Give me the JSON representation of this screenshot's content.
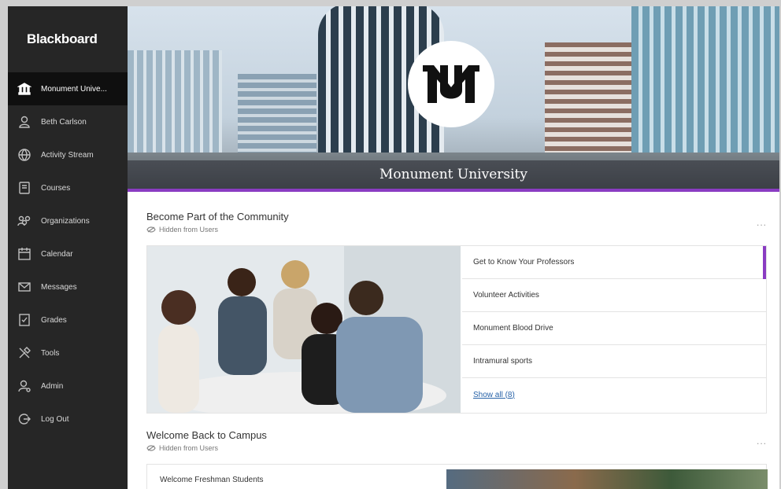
{
  "sidebar": {
    "brand": "Blackboard",
    "items": [
      {
        "label": "Monument Unive...",
        "icon": "institution-icon",
        "active": true
      },
      {
        "label": "Beth Carlson",
        "icon": "user-icon"
      },
      {
        "label": "Activity Stream",
        "icon": "globe-icon"
      },
      {
        "label": "Courses",
        "icon": "book-icon"
      },
      {
        "label": "Organizations",
        "icon": "people-icon"
      },
      {
        "label": "Calendar",
        "icon": "calendar-icon"
      },
      {
        "label": "Messages",
        "icon": "envelope-icon"
      },
      {
        "label": "Grades",
        "icon": "grades-icon"
      },
      {
        "label": "Tools",
        "icon": "tools-icon"
      },
      {
        "label": "Admin",
        "icon": "admin-icon"
      },
      {
        "label": "Log Out",
        "icon": "logout-icon"
      }
    ]
  },
  "hero": {
    "title": "Monument University",
    "logo_text": "MU"
  },
  "sections": {
    "community": {
      "title": "Become Part of the Community",
      "visibility": "Hidden from Users",
      "more": "...",
      "links": [
        {
          "label": "Get to Know Your Professors",
          "active": true
        },
        {
          "label": "Volunteer Activities"
        },
        {
          "label": "Monument Blood Drive"
        },
        {
          "label": "Intramural sports"
        }
      ],
      "show_all": "Show all (8)"
    },
    "welcome": {
      "title": "Welcome Back to Campus",
      "visibility": "Hidden from Users",
      "more": "...",
      "first_item": "Welcome Freshman Students"
    }
  },
  "colors": {
    "sidebar_bg": "#262626",
    "accent": "#8a3cc2",
    "link": "#2762a8"
  }
}
